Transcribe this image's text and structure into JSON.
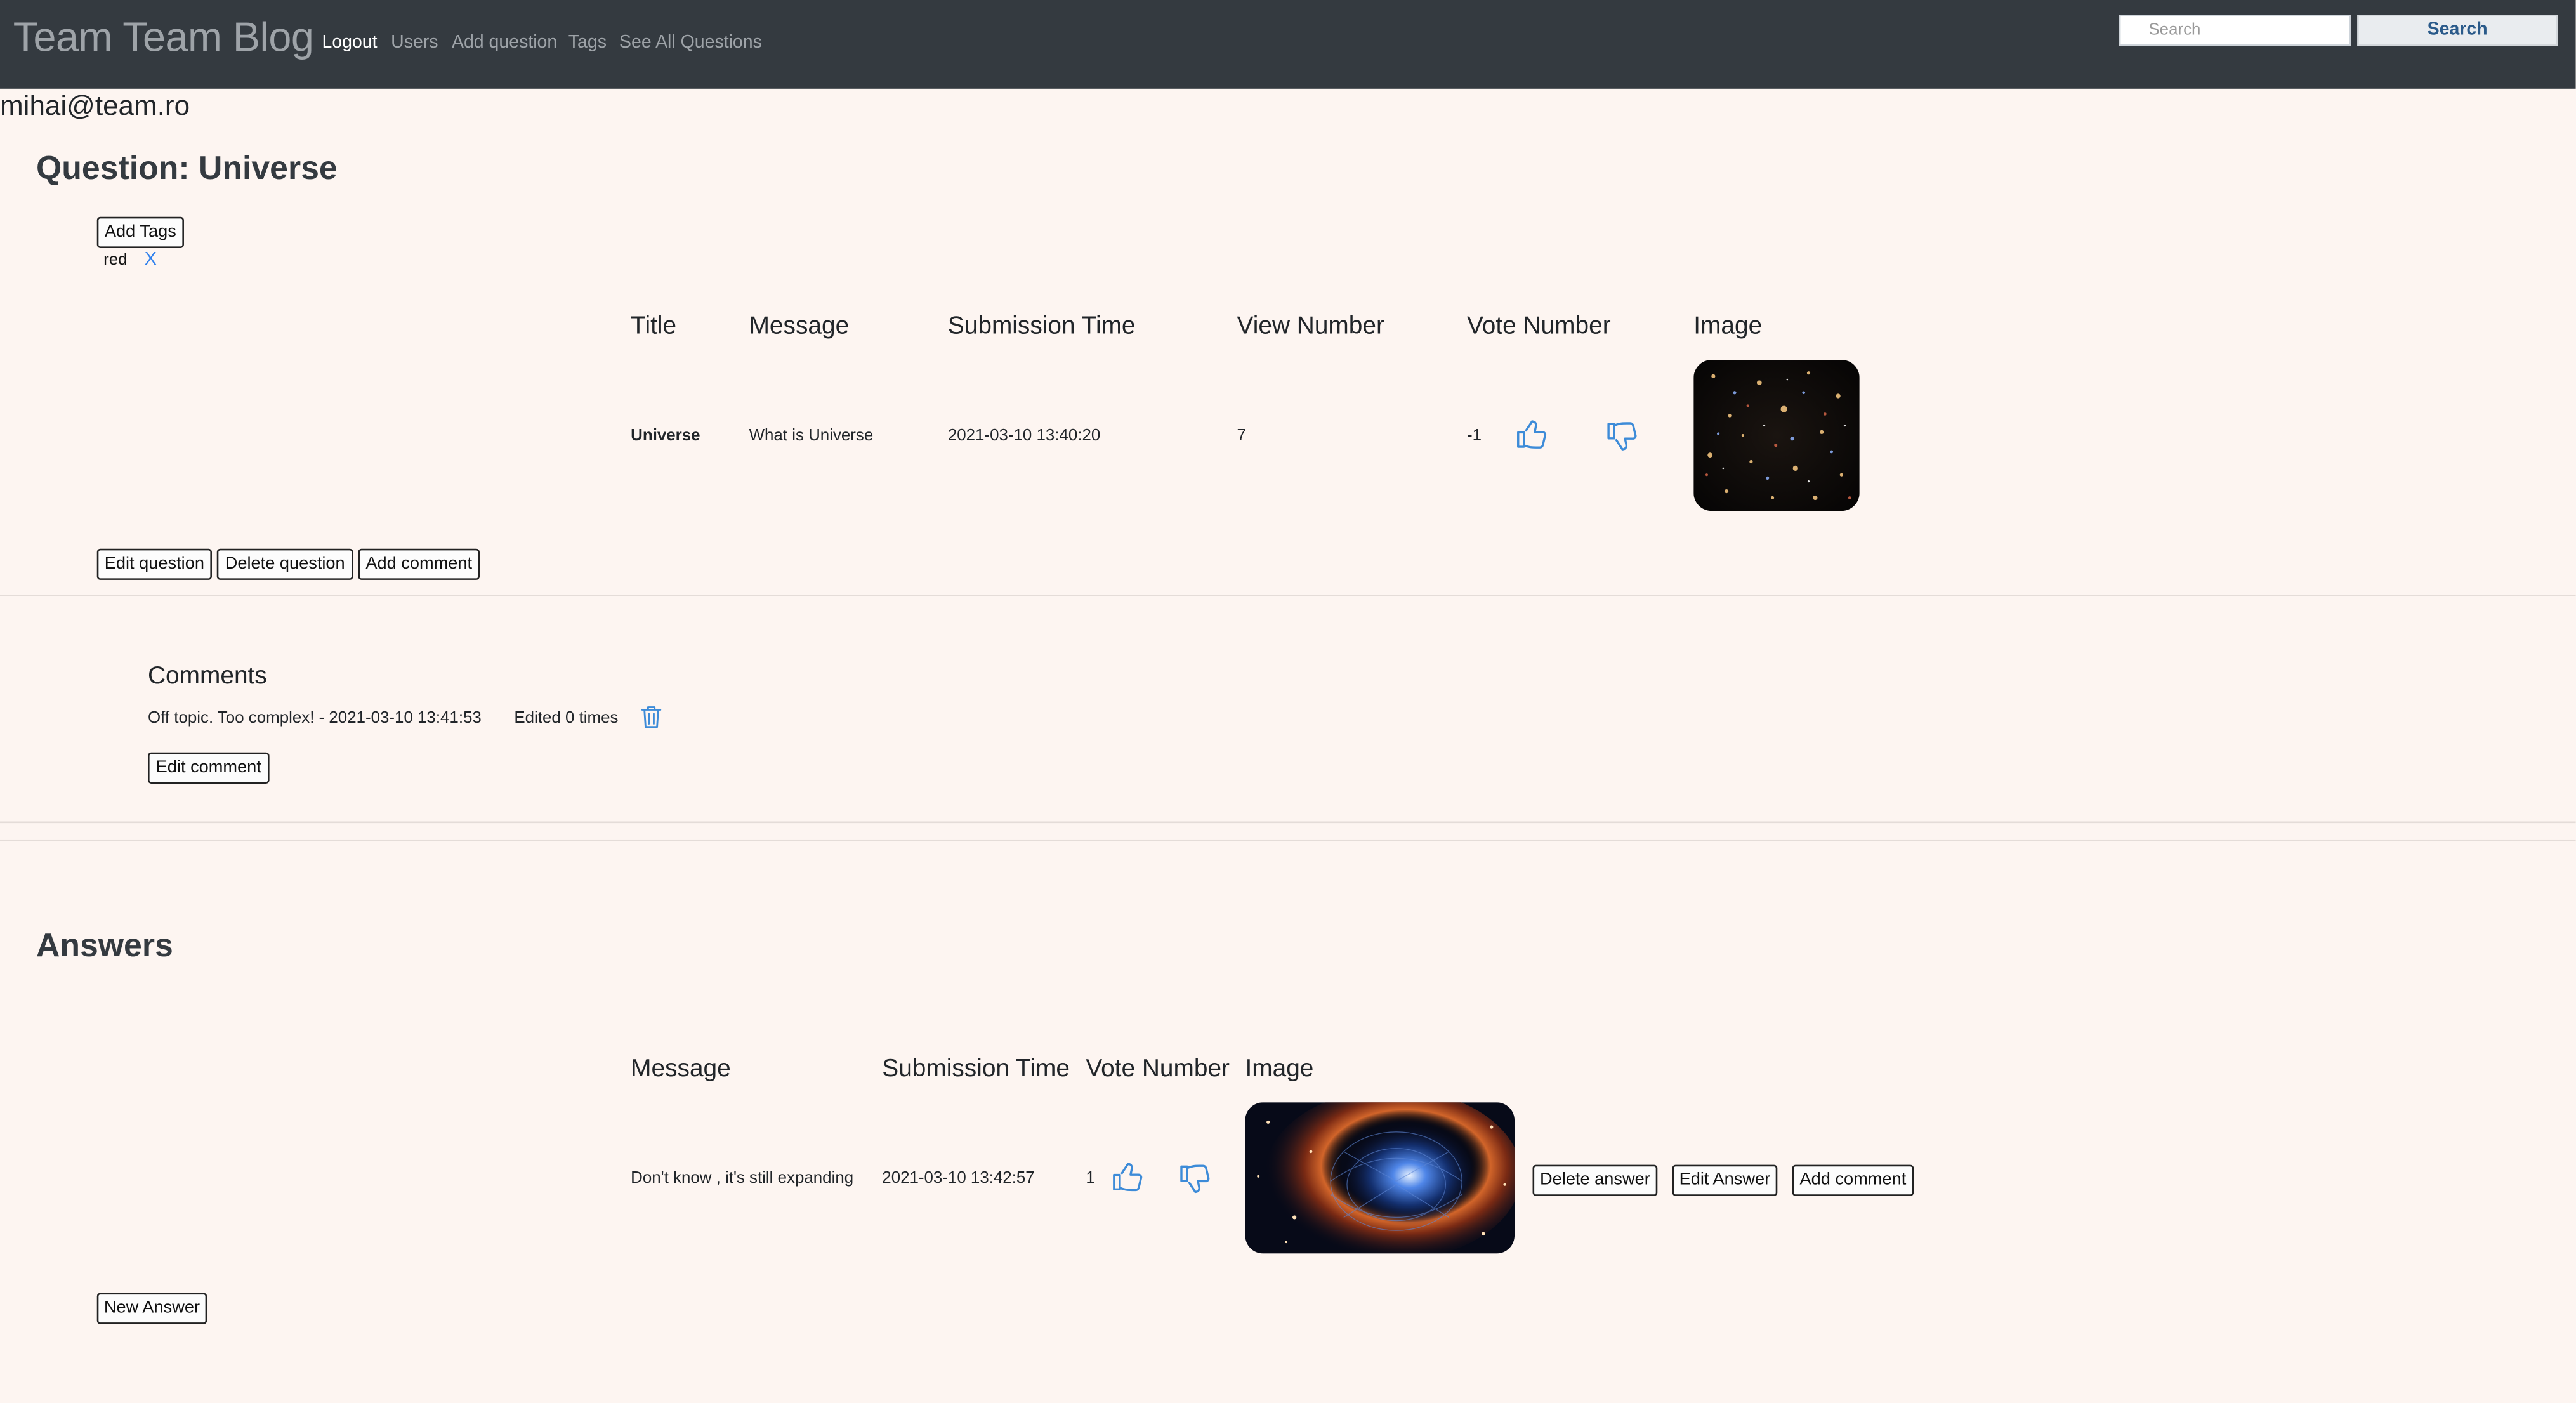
{
  "navbar": {
    "brand": "Team Team Blog",
    "links": [
      "Logout",
      "Users",
      "Add question",
      "Tags",
      "See All Questions"
    ],
    "search_placeholder": "Search",
    "search_button": "Search"
  },
  "user": {
    "email": "mihai@team.ro"
  },
  "question": {
    "heading": "Question: Universe",
    "add_tags_button": "Add Tags",
    "tag": {
      "name": "red",
      "remove": "X"
    },
    "table": {
      "headers": [
        "Title",
        "Message",
        "Submission Time",
        "View Number",
        "Vote Number",
        "Image"
      ],
      "row": {
        "title": "Universe",
        "message": "What is Universe",
        "submission_time": "2021-03-10 13:40:20",
        "view_number": "7",
        "vote_number": "-1"
      }
    },
    "buttons": {
      "edit": "Edit question",
      "delete": "Delete question",
      "add_comment": "Add comment"
    }
  },
  "comments": {
    "heading": "Comments",
    "items": [
      {
        "text": "Off topic. Too complex! - 2021-03-10 13:41:53",
        "edited": "Edited 0 times"
      }
    ],
    "edit_button": "Edit comment"
  },
  "answers": {
    "heading": "Answers",
    "table": {
      "headers": [
        "Message",
        "Submission Time",
        "Vote Number",
        "Image"
      ],
      "row": {
        "message": "Don't know , it's still expanding",
        "submission_time": "2021-03-10 13:42:57",
        "vote_number": "1"
      }
    },
    "buttons": {
      "delete": "Delete answer",
      "edit": "Edit Answer",
      "add_comment": "Add comment"
    },
    "new_answer_button": "New Answer"
  },
  "colors": {
    "navbar": "#343a40",
    "background": "#fdf5f1",
    "link_blue": "#2f80ed"
  },
  "icons": [
    "thumbs-up-icon",
    "thumbs-down-icon",
    "trash-icon"
  ]
}
